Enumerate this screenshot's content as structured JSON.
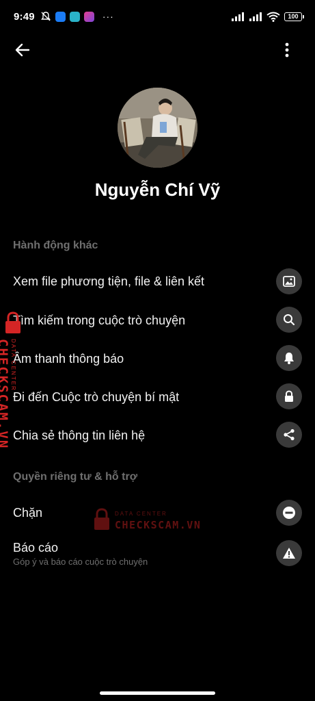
{
  "status_bar": {
    "time": "9:49",
    "dots": "···",
    "battery": "100",
    "icons": [
      "mute-icon",
      "zalo-app-icon",
      "app-icon",
      "app-icon",
      "signal-icon",
      "signal-icon",
      "wifi-icon",
      "battery-icon"
    ]
  },
  "top_bar": {
    "back_icon": "arrow-left-icon",
    "more_icon": "more-vertical-icon"
  },
  "profile": {
    "name": "Nguyễn Chí Vỹ"
  },
  "sections": {
    "more_actions": {
      "title": "Hành động khác",
      "items": [
        {
          "label": "Xem file phương tiện, file & liên kết",
          "icon": "image-icon"
        },
        {
          "label": "Tìm kiếm trong cuộc trò chuyện",
          "icon": "search-icon"
        },
        {
          "label": "Âm thanh thông báo",
          "icon": "bell-icon"
        },
        {
          "label": "Đi đến Cuộc trò chuyện bí mật",
          "icon": "lock-icon"
        },
        {
          "label": "Chia sẻ thông tin liên hệ",
          "icon": "share-icon"
        }
      ]
    },
    "privacy": {
      "title": "Quyền riêng tư & hỗ trợ",
      "items": [
        {
          "label": "Chặn",
          "icon": "block-icon"
        },
        {
          "label": "Báo cáo",
          "sub": "Góp ý và báo cáo cuộc trò chuyện",
          "icon": "warning-icon"
        }
      ]
    }
  },
  "watermark": {
    "brand": "CHECKSCAM.VN",
    "tag": "DATA CENTER"
  },
  "colors": {
    "background": "#000000",
    "icon_bg": "#3a3a3a",
    "muted_text": "#6f6f6f",
    "watermark_red": "#d42525"
  }
}
